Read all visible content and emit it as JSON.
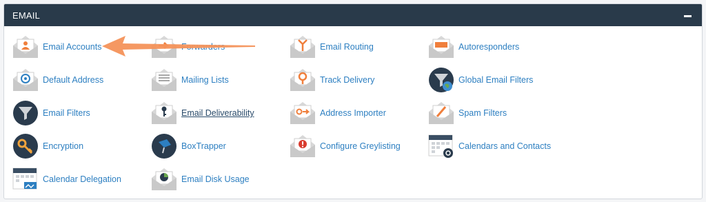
{
  "panel": {
    "title": "EMAIL"
  },
  "items": [
    {
      "label": "Email Accounts",
      "icon": "envelope-person-icon"
    },
    {
      "label": "Forwarders",
      "icon": "envelope-forward-icon"
    },
    {
      "label": "Email Routing",
      "icon": "envelope-routing-icon"
    },
    {
      "label": "Autoresponders",
      "icon": "envelope-auto-icon"
    },
    {
      "label": "Default Address",
      "icon": "envelope-at-icon"
    },
    {
      "label": "Mailing Lists",
      "icon": "envelope-list-icon"
    },
    {
      "label": "Track Delivery",
      "icon": "envelope-pin-icon"
    },
    {
      "label": "Global Email Filters",
      "icon": "funnel-globe-icon"
    },
    {
      "label": "Email Filters",
      "icon": "funnel-icon"
    },
    {
      "label": "Email Deliverability",
      "icon": "envelope-key-icon"
    },
    {
      "label": "Address Importer",
      "icon": "envelope-import-icon"
    },
    {
      "label": "Spam Filters",
      "icon": "envelope-spam-icon"
    },
    {
      "label": "Encryption",
      "icon": "key-icon"
    },
    {
      "label": "BoxTrapper",
      "icon": "boxtrapper-icon"
    },
    {
      "label": "Configure Greylisting",
      "icon": "envelope-alert-icon"
    },
    {
      "label": "Calendars and Contacts",
      "icon": "calendar-contacts-icon"
    },
    {
      "label": "Calendar Delegation",
      "icon": "calendar-delegation-icon"
    },
    {
      "label": "Email Disk Usage",
      "icon": "envelope-disk-icon"
    }
  ],
  "colors": {
    "header": "#293a4a",
    "link": "#2d7fc1",
    "accent": "#f07f3c",
    "annotation_arrow": "#f4925a"
  }
}
